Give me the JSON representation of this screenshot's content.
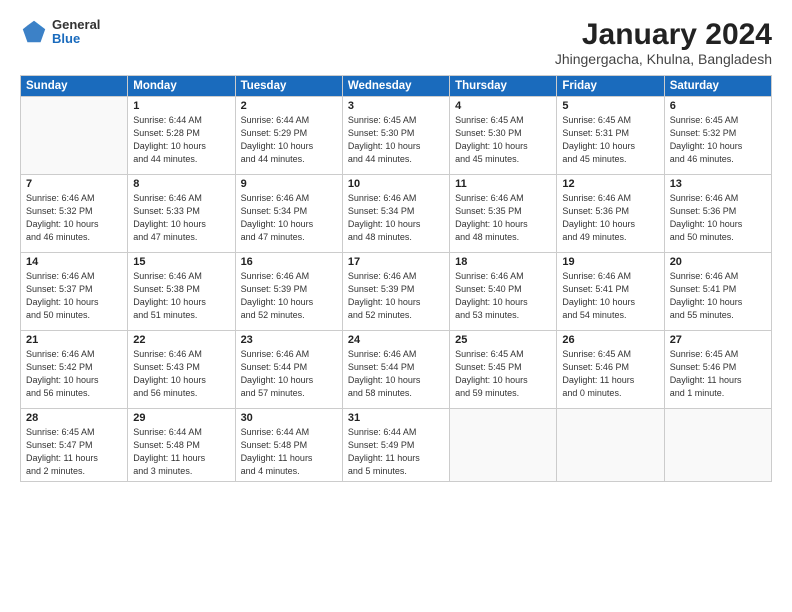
{
  "logo": {
    "general": "General",
    "blue": "Blue"
  },
  "header": {
    "month": "January 2024",
    "location": "Jhingergacha, Khulna, Bangladesh"
  },
  "weekdays": [
    "Sunday",
    "Monday",
    "Tuesday",
    "Wednesday",
    "Thursday",
    "Friday",
    "Saturday"
  ],
  "weeks": [
    [
      {
        "day": "",
        "content": ""
      },
      {
        "day": "1",
        "content": "Sunrise: 6:44 AM\nSunset: 5:28 PM\nDaylight: 10 hours\nand 44 minutes."
      },
      {
        "day": "2",
        "content": "Sunrise: 6:44 AM\nSunset: 5:29 PM\nDaylight: 10 hours\nand 44 minutes."
      },
      {
        "day": "3",
        "content": "Sunrise: 6:45 AM\nSunset: 5:30 PM\nDaylight: 10 hours\nand 44 minutes."
      },
      {
        "day": "4",
        "content": "Sunrise: 6:45 AM\nSunset: 5:30 PM\nDaylight: 10 hours\nand 45 minutes."
      },
      {
        "day": "5",
        "content": "Sunrise: 6:45 AM\nSunset: 5:31 PM\nDaylight: 10 hours\nand 45 minutes."
      },
      {
        "day": "6",
        "content": "Sunrise: 6:45 AM\nSunset: 5:32 PM\nDaylight: 10 hours\nand 46 minutes."
      }
    ],
    [
      {
        "day": "7",
        "content": "Sunrise: 6:46 AM\nSunset: 5:32 PM\nDaylight: 10 hours\nand 46 minutes."
      },
      {
        "day": "8",
        "content": "Sunrise: 6:46 AM\nSunset: 5:33 PM\nDaylight: 10 hours\nand 47 minutes."
      },
      {
        "day": "9",
        "content": "Sunrise: 6:46 AM\nSunset: 5:34 PM\nDaylight: 10 hours\nand 47 minutes."
      },
      {
        "day": "10",
        "content": "Sunrise: 6:46 AM\nSunset: 5:34 PM\nDaylight: 10 hours\nand 48 minutes."
      },
      {
        "day": "11",
        "content": "Sunrise: 6:46 AM\nSunset: 5:35 PM\nDaylight: 10 hours\nand 48 minutes."
      },
      {
        "day": "12",
        "content": "Sunrise: 6:46 AM\nSunset: 5:36 PM\nDaylight: 10 hours\nand 49 minutes."
      },
      {
        "day": "13",
        "content": "Sunrise: 6:46 AM\nSunset: 5:36 PM\nDaylight: 10 hours\nand 50 minutes."
      }
    ],
    [
      {
        "day": "14",
        "content": "Sunrise: 6:46 AM\nSunset: 5:37 PM\nDaylight: 10 hours\nand 50 minutes."
      },
      {
        "day": "15",
        "content": "Sunrise: 6:46 AM\nSunset: 5:38 PM\nDaylight: 10 hours\nand 51 minutes."
      },
      {
        "day": "16",
        "content": "Sunrise: 6:46 AM\nSunset: 5:39 PM\nDaylight: 10 hours\nand 52 minutes."
      },
      {
        "day": "17",
        "content": "Sunrise: 6:46 AM\nSunset: 5:39 PM\nDaylight: 10 hours\nand 52 minutes."
      },
      {
        "day": "18",
        "content": "Sunrise: 6:46 AM\nSunset: 5:40 PM\nDaylight: 10 hours\nand 53 minutes."
      },
      {
        "day": "19",
        "content": "Sunrise: 6:46 AM\nSunset: 5:41 PM\nDaylight: 10 hours\nand 54 minutes."
      },
      {
        "day": "20",
        "content": "Sunrise: 6:46 AM\nSunset: 5:41 PM\nDaylight: 10 hours\nand 55 minutes."
      }
    ],
    [
      {
        "day": "21",
        "content": "Sunrise: 6:46 AM\nSunset: 5:42 PM\nDaylight: 10 hours\nand 56 minutes."
      },
      {
        "day": "22",
        "content": "Sunrise: 6:46 AM\nSunset: 5:43 PM\nDaylight: 10 hours\nand 56 minutes."
      },
      {
        "day": "23",
        "content": "Sunrise: 6:46 AM\nSunset: 5:44 PM\nDaylight: 10 hours\nand 57 minutes."
      },
      {
        "day": "24",
        "content": "Sunrise: 6:46 AM\nSunset: 5:44 PM\nDaylight: 10 hours\nand 58 minutes."
      },
      {
        "day": "25",
        "content": "Sunrise: 6:45 AM\nSunset: 5:45 PM\nDaylight: 10 hours\nand 59 minutes."
      },
      {
        "day": "26",
        "content": "Sunrise: 6:45 AM\nSunset: 5:46 PM\nDaylight: 11 hours\nand 0 minutes."
      },
      {
        "day": "27",
        "content": "Sunrise: 6:45 AM\nSunset: 5:46 PM\nDaylight: 11 hours\nand 1 minute."
      }
    ],
    [
      {
        "day": "28",
        "content": "Sunrise: 6:45 AM\nSunset: 5:47 PM\nDaylight: 11 hours\nand 2 minutes."
      },
      {
        "day": "29",
        "content": "Sunrise: 6:44 AM\nSunset: 5:48 PM\nDaylight: 11 hours\nand 3 minutes."
      },
      {
        "day": "30",
        "content": "Sunrise: 6:44 AM\nSunset: 5:48 PM\nDaylight: 11 hours\nand 4 minutes."
      },
      {
        "day": "31",
        "content": "Sunrise: 6:44 AM\nSunset: 5:49 PM\nDaylight: 11 hours\nand 5 minutes."
      },
      {
        "day": "",
        "content": ""
      },
      {
        "day": "",
        "content": ""
      },
      {
        "day": "",
        "content": ""
      }
    ]
  ]
}
